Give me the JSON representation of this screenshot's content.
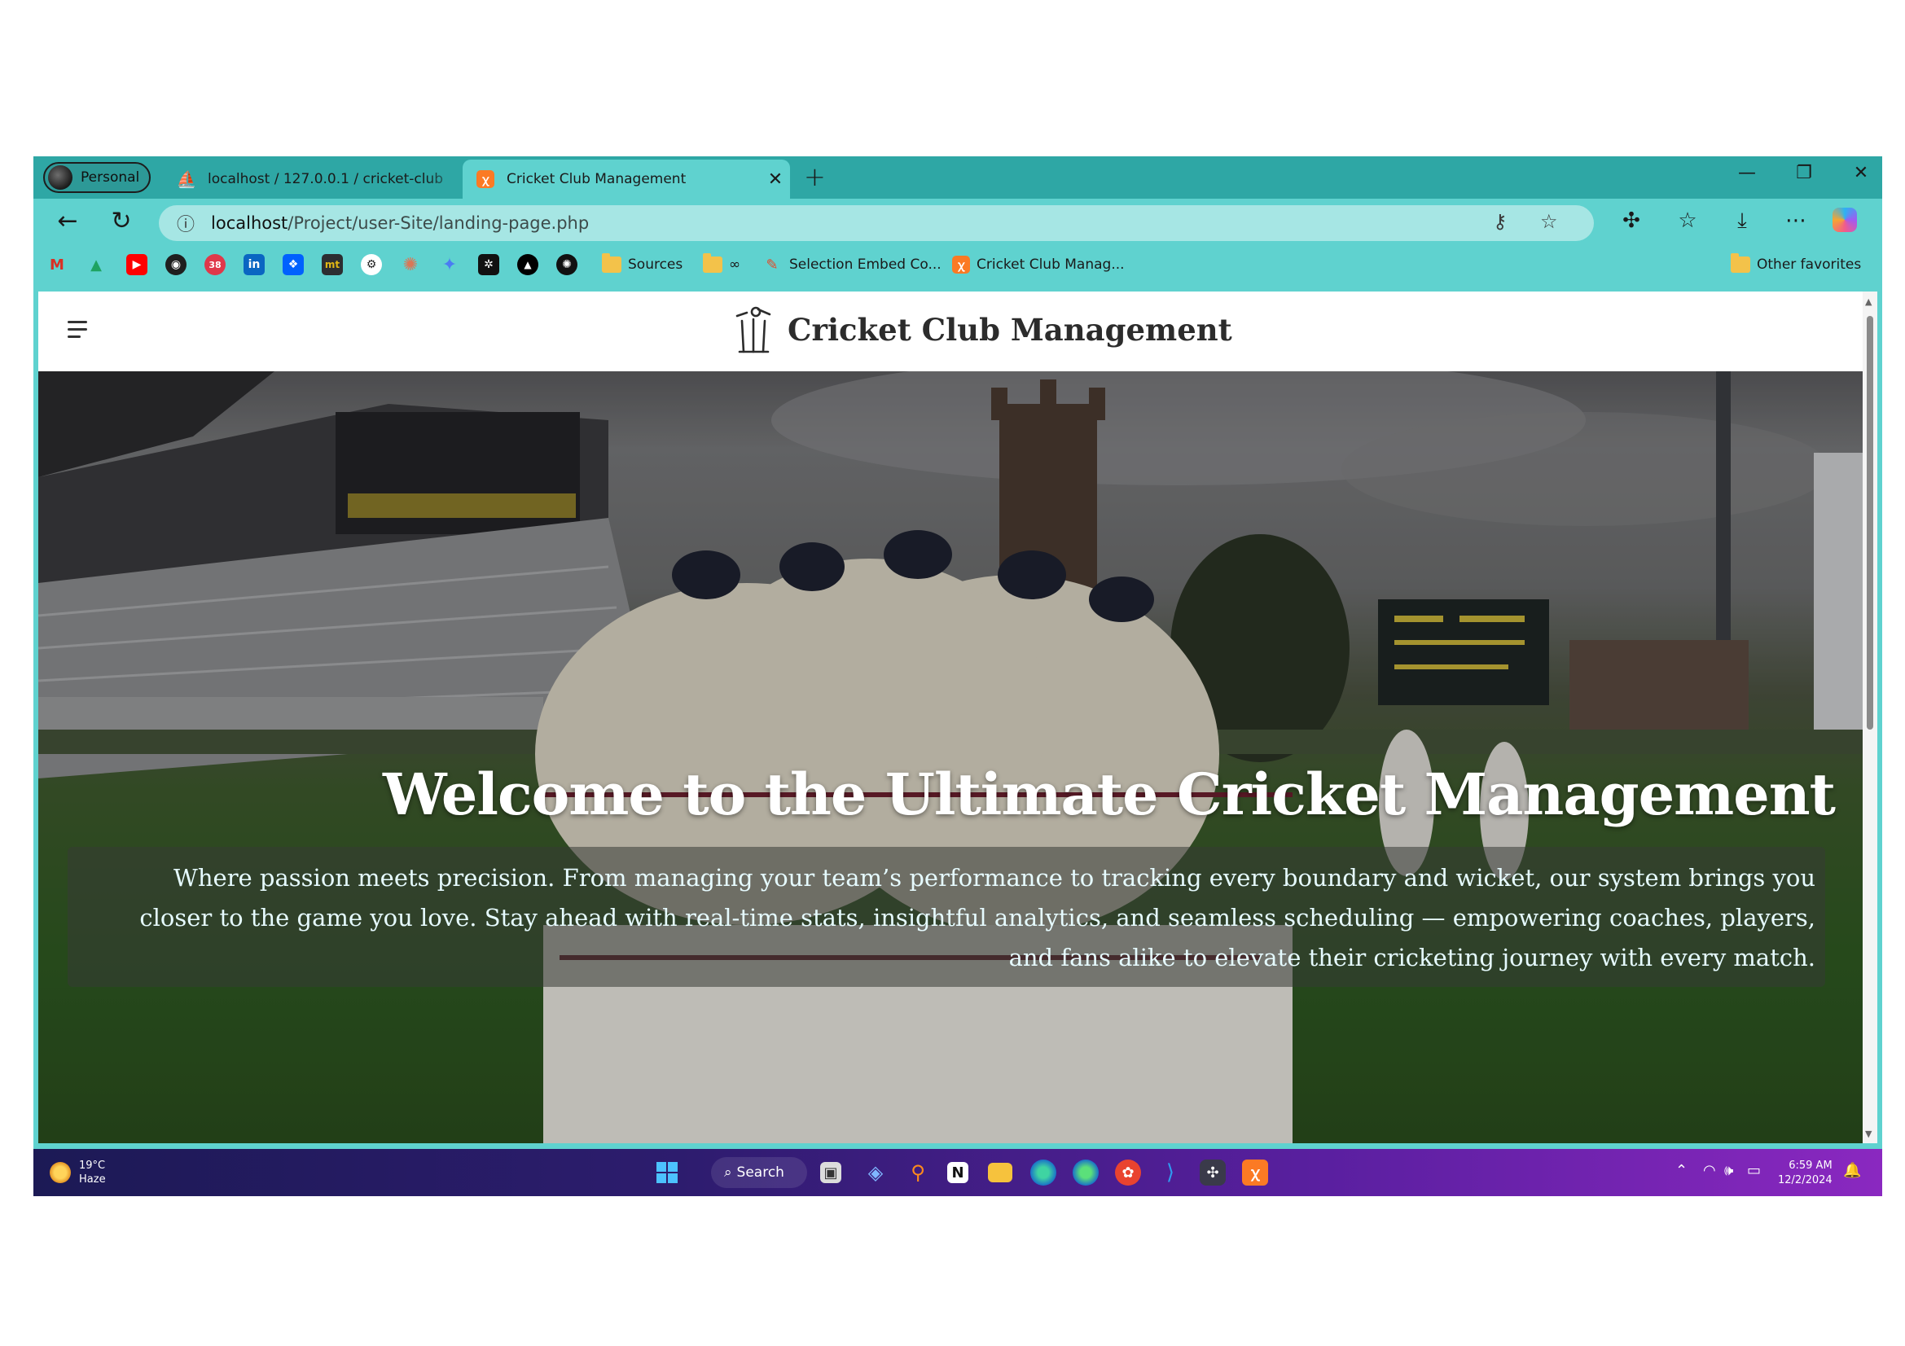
{
  "browser": {
    "profile_label": "Personal",
    "tabs": [
      {
        "title": "localhost / 127.0.0.1 / cricket-club",
        "close": "✕"
      },
      {
        "title": "Cricket Club Management",
        "close": "✕"
      }
    ],
    "new_tab": "+",
    "window_controls": {
      "minimize": "—",
      "restore": "❐",
      "close": "✕"
    },
    "url": {
      "host": "localhost",
      "path": "/Project/user-Site/landing-page.php"
    },
    "bookmarks": [
      {
        "label": "Sources"
      },
      {
        "label": "∞"
      },
      {
        "label": "Selection Embed Co..."
      },
      {
        "label": "Cricket Club Manag..."
      },
      {
        "label": "Other favorites"
      }
    ]
  },
  "site": {
    "brand": "Cricket Club Management",
    "hero": {
      "title": "Welcome to the Ultimate Cricket Management",
      "description": "Where passion meets precision. From managing your team’s performance to tracking every boundary and wicket, our system brings you closer to the game you love. Stay ahead with real-time stats, insightful analytics, and seamless scheduling — empowering coaches, players, and fans alike to elevate their cricketing journey with every match."
    }
  },
  "taskbar": {
    "weather": {
      "temp": "19°C",
      "condition": "Haze"
    },
    "search_label": "Search",
    "clock": {
      "time": "6:59 AM",
      "date": "12/2/2024"
    },
    "accent": "#5fd2cf"
  }
}
